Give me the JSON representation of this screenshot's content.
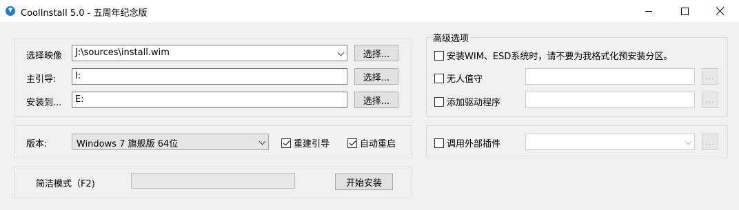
{
  "window": {
    "title": "CoolInstall 5.0 - 五周年纪念版",
    "icon": "download-icon",
    "controls": [
      "minimize",
      "maximize",
      "close"
    ]
  },
  "paths": {
    "image_label": "选择映像",
    "image_value": "J:\\sources\\install.wim",
    "image_button": "选择...",
    "boot_label": "主引导:",
    "boot_value": "I:",
    "boot_button": "选择...",
    "install_label": "安装到...",
    "install_value": "E:",
    "install_button": "选择..."
  },
  "version": {
    "label": "版本:",
    "selected": "Windows 7 旗舰版  64位",
    "rebuild_boot_label": "重建引导",
    "rebuild_boot_checked": true,
    "auto_restart_label": "自动重启",
    "auto_restart_checked": true
  },
  "simple": {
    "mode_label": "简洁模式（F2)",
    "progress": 0,
    "start_button": "开始安装"
  },
  "advanced": {
    "title": "高级选项",
    "no_format_label": "安装WIM、ESD系统时，请不要为我格式化预安装分区。",
    "no_format_checked": false,
    "unattended_label": "无人值守",
    "unattended_checked": false,
    "unattended_value": "",
    "unattended_button": "...",
    "add_driver_label": "添加驱动程序",
    "add_driver_checked": false,
    "add_driver_value": "",
    "add_driver_button": "...",
    "plugin_label": "调用外部插件",
    "plugin_checked": false,
    "plugin_value": "",
    "plugin_button": "..."
  }
}
